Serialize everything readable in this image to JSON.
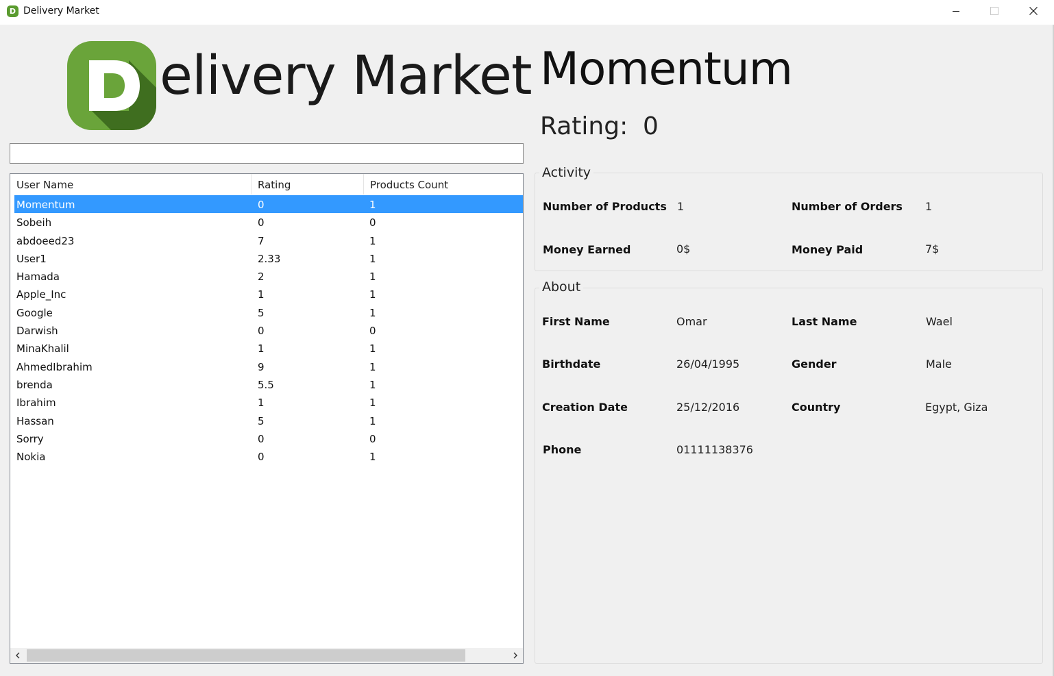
{
  "window": {
    "title": "Delivery Market",
    "icon_letter": "D"
  },
  "logo": {
    "letter": "D",
    "text": "elivery Market",
    "colors": {
      "green": "#6aa43a",
      "dark_green": "#3f6e1f"
    }
  },
  "search": {
    "value": "",
    "placeholder": ""
  },
  "users_table": {
    "columns": [
      "User Name",
      "Rating",
      "Products Count"
    ],
    "rows": [
      {
        "user_name": "Momentum",
        "rating": "0",
        "products_count": "1",
        "selected": true
      },
      {
        "user_name": "Sobeih",
        "rating": "0",
        "products_count": "0"
      },
      {
        "user_name": "abdoeed23",
        "rating": "7",
        "products_count": "1"
      },
      {
        "user_name": "User1",
        "rating": "2.33",
        "products_count": "1"
      },
      {
        "user_name": "Hamada",
        "rating": "2",
        "products_count": "1"
      },
      {
        "user_name": "Apple_Inc",
        "rating": "1",
        "products_count": "1"
      },
      {
        "user_name": "Google",
        "rating": "5",
        "products_count": "1"
      },
      {
        "user_name": "Darwish",
        "rating": "0",
        "products_count": "0"
      },
      {
        "user_name": "MinaKhalil",
        "rating": "1",
        "products_count": "1"
      },
      {
        "user_name": "AhmedIbrahim",
        "rating": "9",
        "products_count": "1"
      },
      {
        "user_name": "brenda",
        "rating": "5.5",
        "products_count": "1"
      },
      {
        "user_name": "Ibrahim",
        "rating": "1",
        "products_count": "1"
      },
      {
        "user_name": "Hassan",
        "rating": "5",
        "products_count": "1"
      },
      {
        "user_name": "Sorry",
        "rating": "0",
        "products_count": "0"
      },
      {
        "user_name": "Nokia",
        "rating": "0",
        "products_count": "1"
      }
    ],
    "selection_color": "#3399ff"
  },
  "profile": {
    "name": "Momentum",
    "rating_label": "Rating:",
    "rating_value": "0"
  },
  "activity": {
    "title": "Activity",
    "number_of_products_label": "Number of Products",
    "number_of_products": "1",
    "number_of_orders_label": "Number of Orders",
    "number_of_orders": "1",
    "money_earned_label": "Money Earned",
    "money_earned": "0$",
    "money_paid_label": "Money Paid",
    "money_paid": "7$"
  },
  "about": {
    "title": "About",
    "first_name_label": "First Name",
    "first_name": "Omar",
    "last_name_label": "Last Name",
    "last_name": "Wael",
    "birthdate_label": "Birthdate",
    "birthdate": "26/04/1995",
    "gender_label": "Gender",
    "gender": "Male",
    "creation_date_label": "Creation Date",
    "creation_date": "25/12/2016",
    "country_label": "Country",
    "country": "Egypt, Giza",
    "phone_label": "Phone",
    "phone": "01111138376"
  }
}
